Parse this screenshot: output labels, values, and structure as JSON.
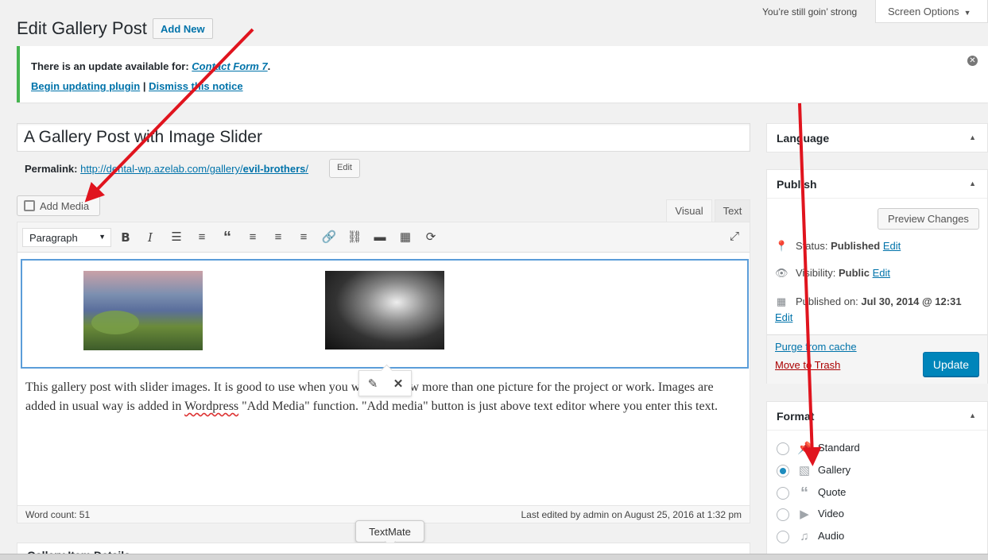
{
  "topbar": {
    "message": "You’re still goin’ strong",
    "screen_options": "Screen Options"
  },
  "header": {
    "title": "Edit Gallery Post",
    "add_new": "Add New"
  },
  "notice": {
    "prefix": "There is an update available for: ",
    "plugin": "Contact Form 7",
    "suffix": ".",
    "begin_link": "Begin updating plugin",
    "separator": " | ",
    "dismiss_link": "Dismiss this notice"
  },
  "post": {
    "title": "A Gallery Post with Image Slider",
    "permalink_label": "Permalink:",
    "permalink_base": "http://dental-wp.azelab.com/gallery/",
    "permalink_slug": "evil-brothers",
    "permalink_end": "/",
    "permalink_edit": "Edit"
  },
  "editor": {
    "add_media": "Add Media",
    "tab_visual": "Visual",
    "tab_text": "Text",
    "format": "Paragraph",
    "content_1": "This gallery post with slider images. It is good to use when you want to show more than one picture for the project or work. Images are added in usual way is added in ",
    "content_spell": "Wordpress",
    "content_2": " \"Add Media\" function. \"Add media\" button is just above text editor where you enter this text.",
    "word_count": "Word count: 51",
    "last_edited": "Last edited by admin on August 25, 2016 at 1:32 pm"
  },
  "tooltip": {
    "textmate": "TextMate"
  },
  "gallery_details": {
    "title": "Gallery Item Details"
  },
  "sidebar": {
    "language": "Language",
    "publish": {
      "title": "Publish",
      "preview": "Preview Changes",
      "status_label": "Status: ",
      "status_value": "Published",
      "visibility_label": "Visibility: ",
      "visibility_value": "Public",
      "published_label": "Published on: ",
      "published_value": "Jul 30, 2014 @ 12:31",
      "edit": "Edit",
      "purge": "Purge from cache",
      "trash": "Move to Trash",
      "update": "Update"
    },
    "format": {
      "title": "Format",
      "options": [
        "Standard",
        "Gallery",
        "Quote",
        "Video",
        "Audio"
      ],
      "selected": "Gallery"
    }
  },
  "colors": {
    "accent": "#0073aa",
    "update_button": "#0085ba",
    "notice_border": "#46b450",
    "annotation_arrow": "#e0141e",
    "trash": "#a00"
  }
}
